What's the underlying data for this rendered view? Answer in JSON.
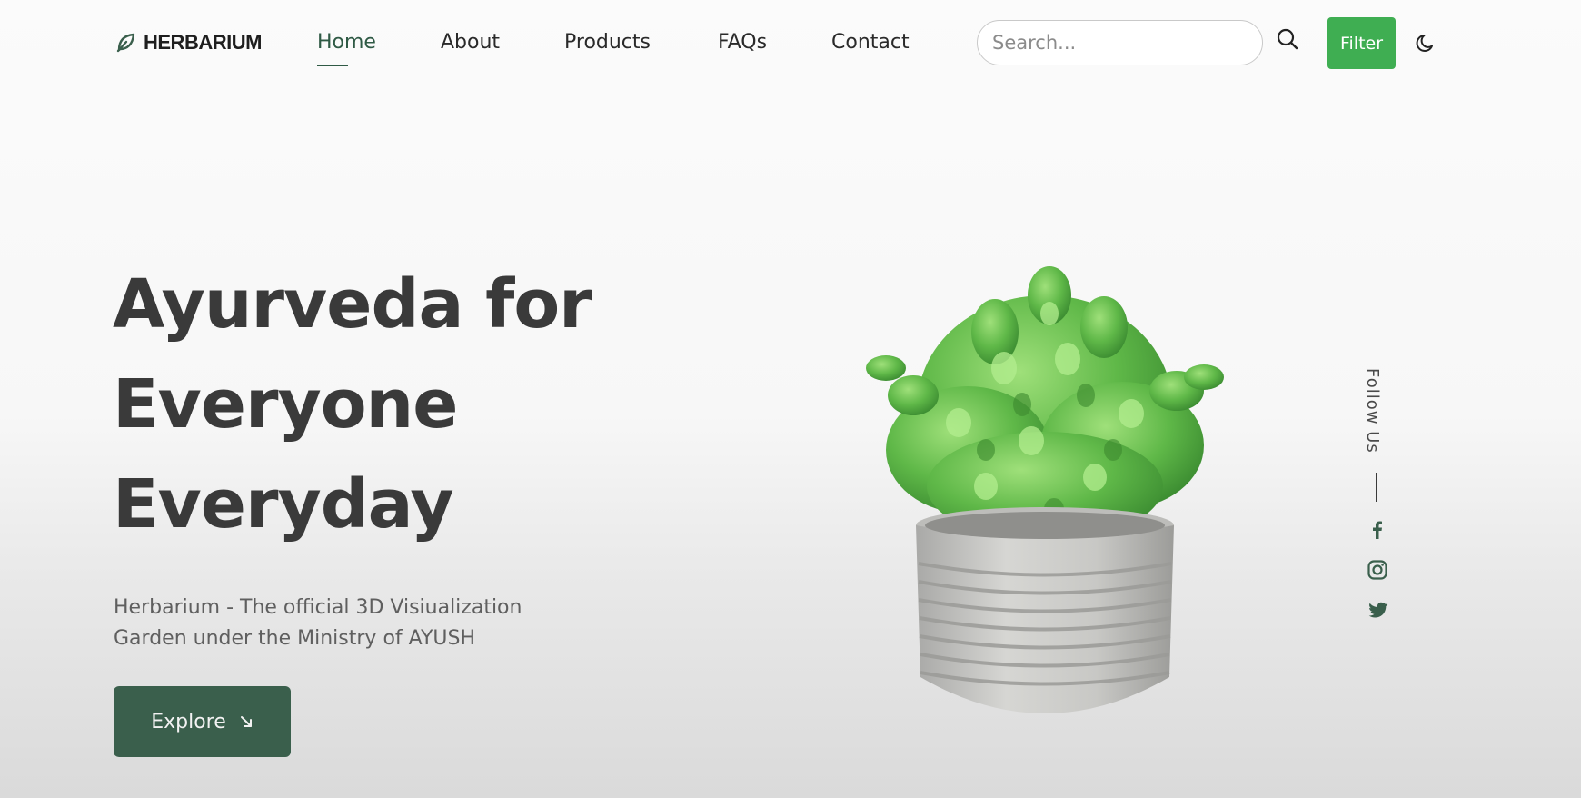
{
  "brand": {
    "name": "HERBARIUM",
    "logo_icon": "leaf-icon"
  },
  "nav": {
    "items": [
      {
        "label": "Home",
        "active": true
      },
      {
        "label": "About",
        "active": false
      },
      {
        "label": "Products",
        "active": false
      },
      {
        "label": "FAQs",
        "active": false
      },
      {
        "label": "Contact",
        "active": false
      }
    ]
  },
  "search": {
    "placeholder": "Search...",
    "value": "",
    "icon": "search-icon"
  },
  "filter_button": {
    "label": "Filter"
  },
  "theme_toggle": {
    "icon": "moon-icon"
  },
  "hero": {
    "title_lines": [
      "Ayurveda for",
      "Everyone",
      "Everyday"
    ],
    "subtitle": "Herbarium - The official 3D Visiualization Garden under the Ministry of AYUSH",
    "cta_label": "Explore",
    "cta_icon": "arrow-down-right-icon"
  },
  "social": {
    "label": "Follow Us",
    "icons": [
      "facebook-icon",
      "instagram-icon",
      "twitter-icon"
    ]
  },
  "colors": {
    "accent_dark": "#3a5f4c",
    "filter_green": "#3fae52",
    "title": "#3a3a3a"
  }
}
